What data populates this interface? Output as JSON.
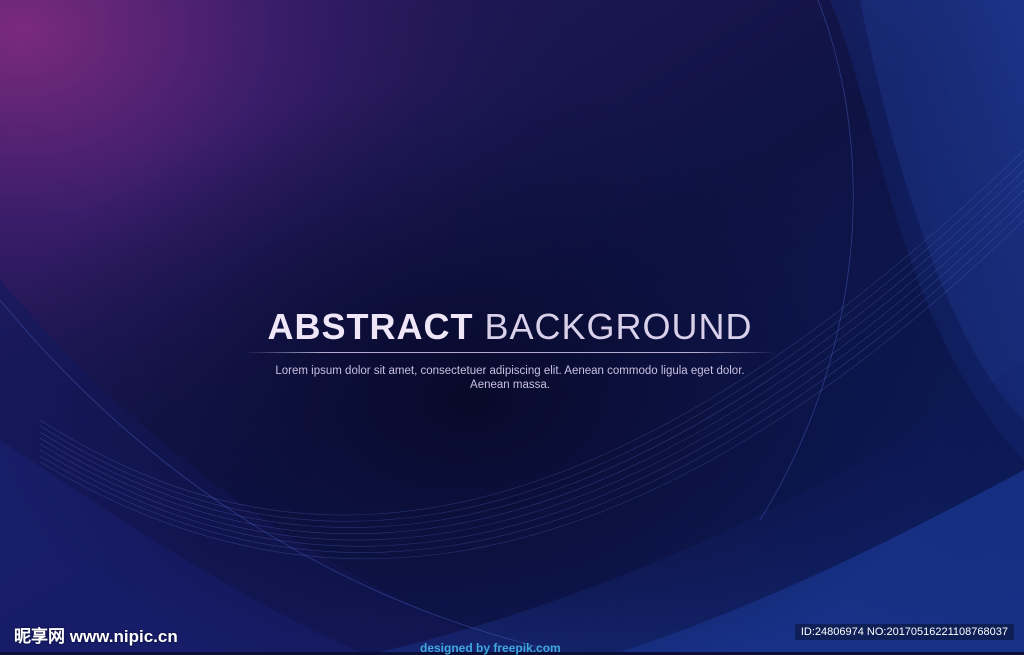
{
  "colors": {
    "background_dark": "#0b0f3a",
    "background_purple": "#7a2a7e",
    "background_blue": "#1e3ea0",
    "title": "#e8dff2",
    "subtitle": "#c9c0e0",
    "credit": "#3fa9e0"
  },
  "main": {
    "title_strong": "ABSTRACT",
    "title_light": "BACKGROUND",
    "subtitle": "Lorem ipsum dolor sit amet, consectetuer adipiscing elit. Aenean commodo ligula eget dolor. Aenean massa."
  },
  "watermark": {
    "site": "昵享网 www.nipic.cn",
    "id_text": "ID:24806974 NO:20170516221108768037"
  },
  "credit": {
    "text": "designed by freepik.com",
    "icon": "freepik-logo-icon"
  }
}
